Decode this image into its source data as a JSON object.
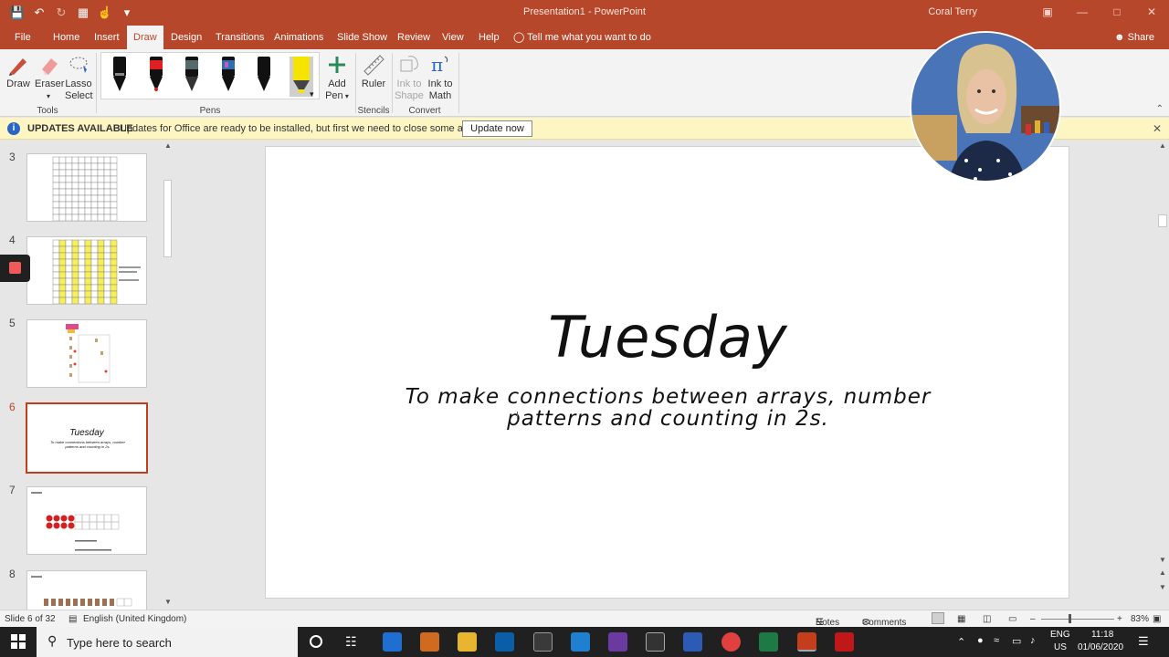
{
  "window": {
    "title": "Presentation1  -  PowerPoint",
    "user": "Coral Terry"
  },
  "tabs": [
    "File",
    "Home",
    "Insert",
    "Draw",
    "Design",
    "Transitions",
    "Animations",
    "Slide Show",
    "Review",
    "View",
    "Help"
  ],
  "active_tab": "Draw",
  "tell_me": "Tell me what you want to do",
  "share": "Share",
  "ribbon": {
    "draw": "Draw",
    "eraser": "Eraser",
    "lasso_line1": "Lasso",
    "lasso_line2": "Select",
    "tools_group": "Tools",
    "pens_group": "Pens",
    "add_pen_line1": "Add",
    "add_pen_line2": "Pen",
    "ruler": "Ruler",
    "stencils_group": "Stencils",
    "ink_to_shape_line1": "Ink to",
    "ink_to_shape_line2": "Shape",
    "ink_to_math_line1": "Ink to",
    "ink_to_math_line2": "Math",
    "convert_group": "Convert",
    "pen_colors": [
      "#111111",
      "#e02020",
      "#556b6b",
      "#2f6fb0",
      "#111111",
      "#f5e400"
    ]
  },
  "notification": {
    "title": "UPDATES AVAILABLE",
    "message": "Updates for Office are ready to be installed, but first we need to close some apps.",
    "button": "Update now"
  },
  "thumbnails": [
    {
      "num": "3",
      "type": "grid"
    },
    {
      "num": "4",
      "type": "grid-yellow"
    },
    {
      "num": "5",
      "type": "worksheet"
    },
    {
      "num": "6",
      "type": "title",
      "title": "Tuesday",
      "sub": "To make connections between arrays, number patterns and counting in 2s."
    },
    {
      "num": "7",
      "type": "array"
    },
    {
      "num": "8",
      "type": "array2"
    }
  ],
  "slide": {
    "title": "Tuesday",
    "subtitle": "To make connections between arrays, number patterns and counting in 2s."
  },
  "status": {
    "slide_info": "Slide 6 of 32",
    "language": "English (United Kingdom)",
    "notes": "Notes",
    "comments": "Comments",
    "zoom": "83%"
  },
  "taskbar": {
    "search_placeholder": "Type here to search",
    "lang1": "ENG",
    "lang2": "US",
    "time": "11:18",
    "date": "01/06/2020"
  }
}
